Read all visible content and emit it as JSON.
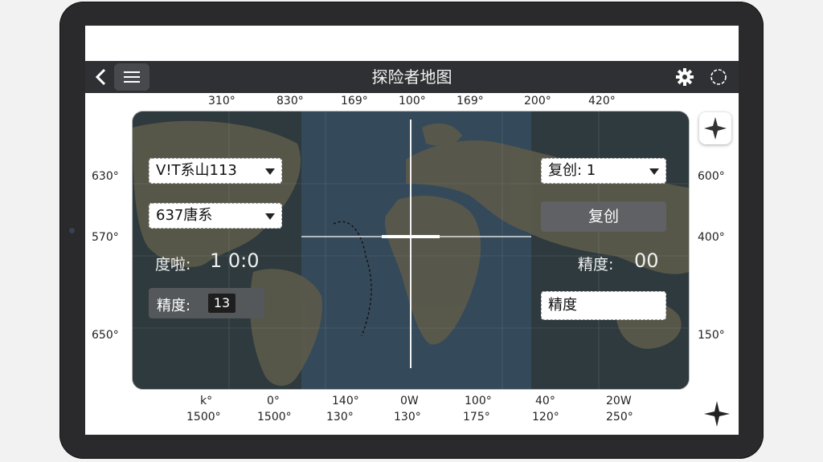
{
  "app": {
    "title": "探险者地图"
  },
  "topbar": {
    "back_icon": "chevron-left-icon",
    "menu_icon": "hamburger-menu-icon",
    "settings_icon": "gear-icon",
    "loading_icon": "dashed-circle-icon"
  },
  "axes": {
    "top": [
      "310°",
      "830°",
      "169°",
      "100°",
      "169°",
      "200°",
      "420°"
    ],
    "bottom_row1": [
      "k°",
      "0°",
      "140°",
      "0W",
      "100°",
      "40°",
      "20W"
    ],
    "bottom_row2": [
      "1500°",
      "1500°",
      "130°",
      "130°",
      "175°",
      "120°",
      "250°"
    ],
    "left": [
      "630°",
      "570°",
      "650°"
    ],
    "right": [
      "600°",
      "400°",
      "150°"
    ]
  },
  "left_panel": {
    "select1_value": "V!T系山113",
    "select2_value": "637唐系",
    "readout_label": "度啦:",
    "readout_value": "1 0:0",
    "precision_label": "精度:",
    "precision_value": "13"
  },
  "right_panel": {
    "select_value": "复创: 1",
    "copy_button": "复创",
    "precision_label": "精度:",
    "precision_value": "00",
    "precision_input": "精度"
  },
  "map": {
    "ocean_color": "#34495a",
    "land_color": "#5b5a4a",
    "crosshair_color": "#f2f2f2"
  },
  "icons": {
    "compass": "compass-star-icon",
    "corner": "sparkle-star-icon"
  }
}
